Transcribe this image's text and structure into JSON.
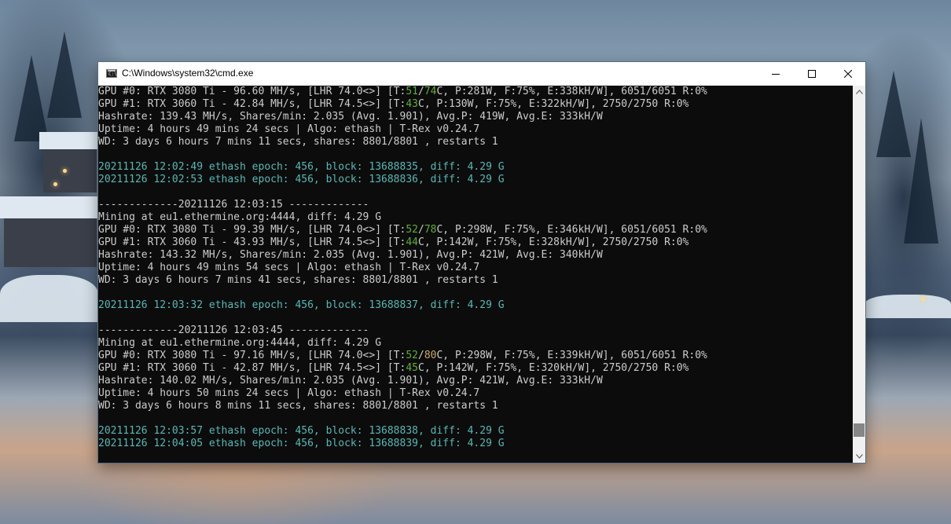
{
  "window": {
    "title": "C:\\Windows\\system32\\cmd.exe",
    "icon": "cmd-icon",
    "controls": [
      "minimize-icon",
      "maximize-icon",
      "close-icon"
    ]
  },
  "colors": {
    "default": "#cccccc",
    "cyan": "#5ab7b6",
    "green": "#5fae3a",
    "yellow": "#c8a96a",
    "background": "#0c0c0c"
  },
  "console": {
    "lines": [
      [
        {
          "t": "GPU #0: RTX 3080 Ti - 96.60 MH/s, [LHR 74.0<>] [T:",
          "c": "gray"
        },
        {
          "t": "51",
          "c": "green"
        },
        {
          "t": "/",
          "c": "gray"
        },
        {
          "t": "74",
          "c": "green"
        },
        {
          "t": "C, P:281W, F:75%, E:338kH/W], 6051/6051 R:0%",
          "c": "gray"
        }
      ],
      [
        {
          "t": "GPU #1: RTX 3060 Ti - 42.84 MH/s, [LHR 74.5<>] [T:",
          "c": "gray"
        },
        {
          "t": "43",
          "c": "green"
        },
        {
          "t": "C, P:130W, F:75%, E:322kH/W], 2750/2750 R:0%",
          "c": "gray"
        }
      ],
      [
        {
          "t": "Hashrate: 139.43 MH/s, Shares/min: 2.035 (Avg. 1.901), Avg.P: 419W, Avg.E: 333kH/W",
          "c": "gray"
        }
      ],
      [
        {
          "t": "Uptime: 4 hours 49 mins 24 secs | Algo: ethash | T-Rex v0.24.7",
          "c": "gray"
        }
      ],
      [
        {
          "t": "WD: 3 days 6 hours 7 mins 11 secs, shares: 8801/8801 , restarts 1",
          "c": "gray"
        }
      ],
      [],
      [
        {
          "t": "20211126 12:02:49 ethash epoch: 456, block: 13688835, diff: 4.29 G",
          "c": "cyan"
        }
      ],
      [
        {
          "t": "20211126 12:02:53 ethash epoch: 456, block: 13688836, diff: 4.29 G",
          "c": "cyan"
        }
      ],
      [],
      [
        {
          "t": "-------------20211126 12:03:15 -------------",
          "c": "gray"
        }
      ],
      [
        {
          "t": "Mining at eu1.ethermine.org:4444, diff: 4.29 G",
          "c": "gray"
        }
      ],
      [
        {
          "t": "GPU #0: RTX 3080 Ti - 99.39 MH/s, [LHR 74.0<>] [T:",
          "c": "gray"
        },
        {
          "t": "52",
          "c": "green"
        },
        {
          "t": "/",
          "c": "gray"
        },
        {
          "t": "78",
          "c": "green"
        },
        {
          "t": "C, P:298W, F:75%, E:346kH/W], 6051/6051 R:0%",
          "c": "gray"
        }
      ],
      [
        {
          "t": "GPU #1: RTX 3060 Ti - 43.93 MH/s, [LHR 74.5<>] [T:",
          "c": "gray"
        },
        {
          "t": "44",
          "c": "green"
        },
        {
          "t": "C, P:142W, F:75%, E:328kH/W], 2750/2750 R:0%",
          "c": "gray"
        }
      ],
      [
        {
          "t": "Hashrate: 143.32 MH/s, Shares/min: 2.035 (Avg. 1.901), Avg.P: 421W, Avg.E: 340kH/W",
          "c": "gray"
        }
      ],
      [
        {
          "t": "Uptime: 4 hours 49 mins 54 secs | Algo: ethash | T-Rex v0.24.7",
          "c": "gray"
        }
      ],
      [
        {
          "t": "WD: 3 days 6 hours 7 mins 41 secs, shares: 8801/8801 , restarts 1",
          "c": "gray"
        }
      ],
      [],
      [
        {
          "t": "20211126 12:03:32 ethash epoch: 456, block: 13688837, diff: 4.29 G",
          "c": "cyan"
        }
      ],
      [],
      [
        {
          "t": "-------------20211126 12:03:45 -------------",
          "c": "gray"
        }
      ],
      [
        {
          "t": "Mining at eu1.ethermine.org:4444, diff: 4.29 G",
          "c": "gray"
        }
      ],
      [
        {
          "t": "GPU #0: RTX 3080 Ti - 97.16 MH/s, [LHR 74.0<>] [T:",
          "c": "gray"
        },
        {
          "t": "52",
          "c": "green"
        },
        {
          "t": "/",
          "c": "gray"
        },
        {
          "t": "80",
          "c": "yellow"
        },
        {
          "t": "C, P:298W, F:75%, E:339kH/W], 6051/6051 R:0%",
          "c": "gray"
        }
      ],
      [
        {
          "t": "GPU #1: RTX 3060 Ti - 42.87 MH/s, [LHR 74.5<>] [T:",
          "c": "gray"
        },
        {
          "t": "45",
          "c": "green"
        },
        {
          "t": "C, P:142W, F:75%, E:320kH/W], 2750/2750 R:0%",
          "c": "gray"
        }
      ],
      [
        {
          "t": "Hashrate: 140.02 MH/s, Shares/min: 2.035 (Avg. 1.901), Avg.P: 421W, Avg.E: 333kH/W",
          "c": "gray"
        }
      ],
      [
        {
          "t": "Uptime: 4 hours 50 mins 24 secs | Algo: ethash | T-Rex v0.24.7",
          "c": "gray"
        }
      ],
      [
        {
          "t": "WD: 3 days 6 hours 8 mins 11 secs, shares: 8801/8801 , restarts 1",
          "c": "gray"
        }
      ],
      [],
      [
        {
          "t": "20211126 12:03:57 ethash epoch: 456, block: 13688838, diff: 4.29 G",
          "c": "cyan"
        }
      ],
      [
        {
          "t": "20211126 12:04:05 ethash epoch: 456, block: 13688839, diff: 4.29 G",
          "c": "cyan"
        }
      ]
    ]
  },
  "scrollbar": {
    "position": 0.96
  }
}
